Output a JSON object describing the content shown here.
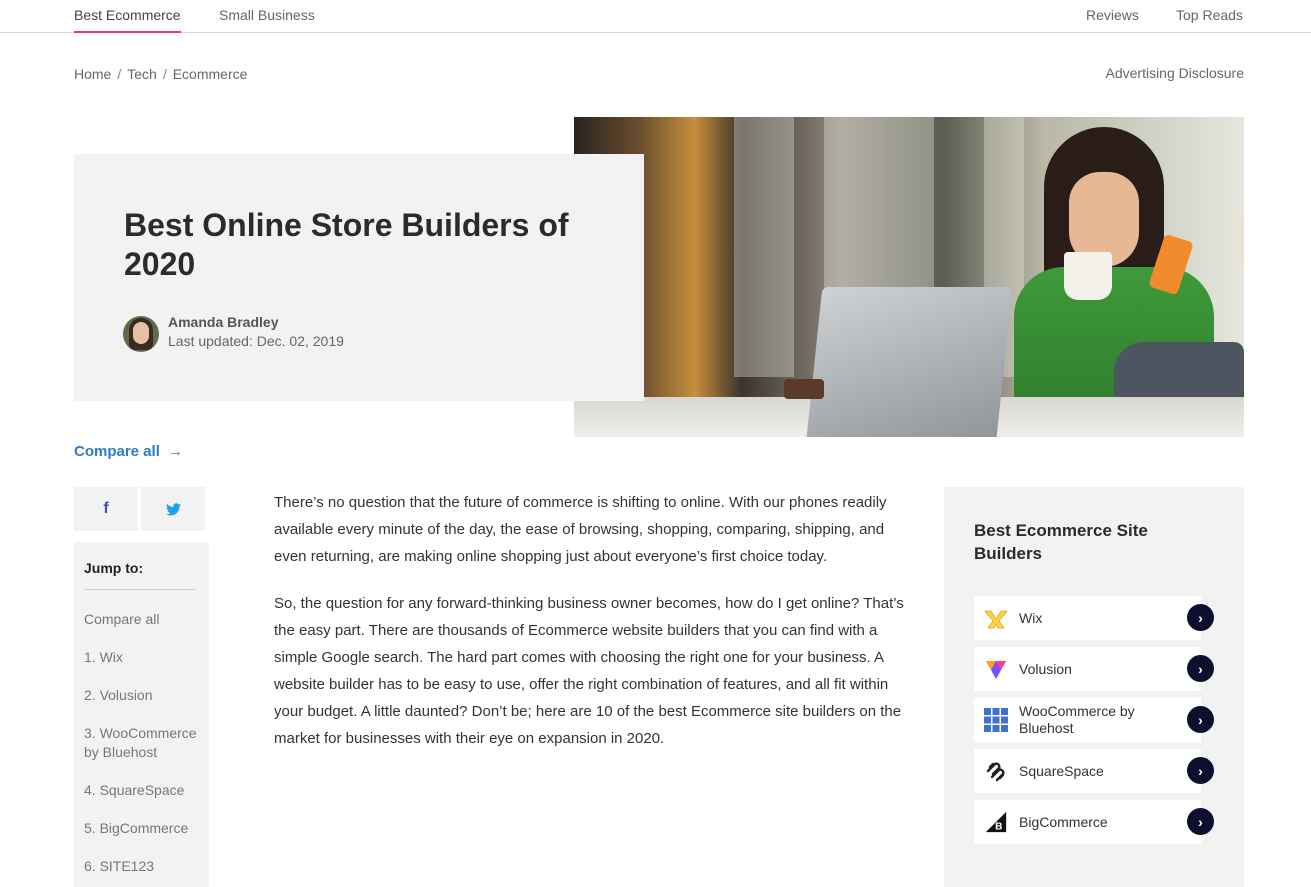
{
  "topnav": {
    "left": [
      {
        "label": "Best Ecommerce",
        "active": true
      },
      {
        "label": "Small Business",
        "active": false
      }
    ],
    "right": [
      {
        "label": "Reviews"
      },
      {
        "label": "Top Reads"
      }
    ]
  },
  "breadcrumb": [
    "Home",
    "Tech",
    "Ecommerce"
  ],
  "breadcrumb_separator": "/",
  "advertising_disclosure": "Advertising Disclosure",
  "hero": {
    "title": "Best Online Store Builders of 2020",
    "author": "Amanda Bradley",
    "updated": "Last updated: Dec. 02, 2019"
  },
  "compare_all": {
    "label": "Compare all",
    "arrow": "→"
  },
  "social": {
    "facebook": "f",
    "twitter": "twitter-bird"
  },
  "jump_to": {
    "title": "Jump to:",
    "items": [
      "Compare all",
      "1. Wix",
      "2. Volusion",
      "3. WooCommerce by Bluehost",
      "4. SquareSpace",
      "5. BigCommerce",
      "6. SITE123"
    ]
  },
  "article": {
    "paragraphs": [
      "There’s no question that the future of commerce is shifting to online. With our phones readily available every minute of the day, the ease of browsing, shopping, comparing, shipping, and even returning, are making online shopping just about everyone’s first choice today.",
      "So, the question for any forward-thinking business owner becomes, how do I get online? That’s the easy part. There are thousands of Ecommerce website builders that you can find with a simple Google search. The hard part comes with choosing the right one for your business. A website builder has to be easy to use, offer the right combination of features, and all fit within your budget. A little daunted? Don’t be; here are 10 of the best Ecommerce site builders on the market for businesses with their eye on expansion in 2020."
    ]
  },
  "sidebar": {
    "title": "Best Ecommerce Site Builders",
    "builders": [
      {
        "name": "Wix",
        "icon": "wix-logo-icon"
      },
      {
        "name": "Volusion",
        "icon": "volusion-logo-icon"
      },
      {
        "name": "WooCommerce by Bluehost",
        "icon": "bluehost-logo-icon"
      },
      {
        "name": "SquareSpace",
        "icon": "squarespace-logo-icon"
      },
      {
        "name": "BigCommerce",
        "icon": "bigcommerce-logo-icon"
      }
    ],
    "go_glyph": "›"
  },
  "colors": {
    "accent_underline": "#e0405f",
    "link_blue": "#2e7cc6",
    "go_button": "#0d0f2e",
    "panel_gray": "#f2f2f2"
  }
}
